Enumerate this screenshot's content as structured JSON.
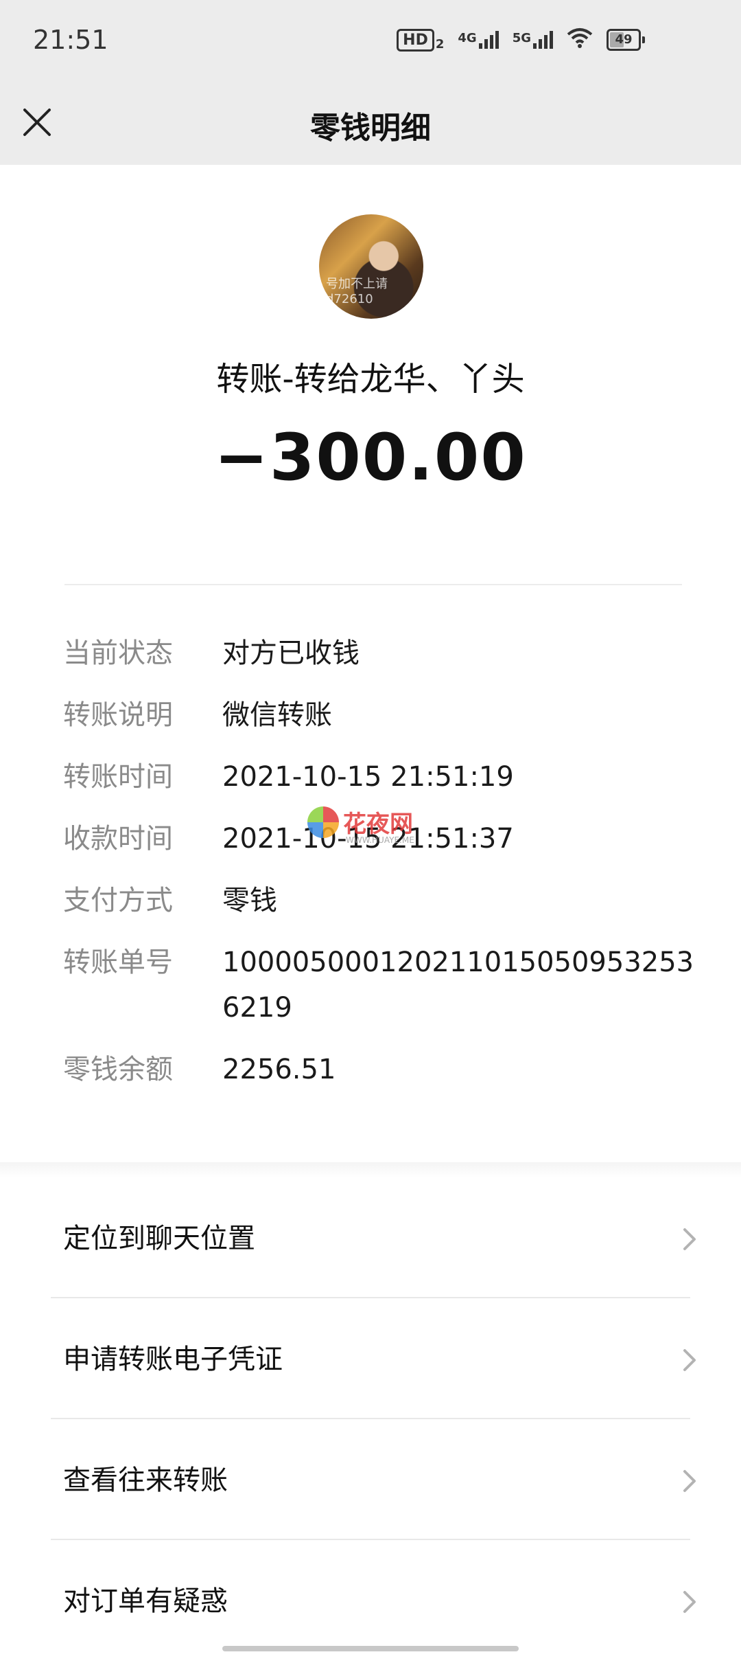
{
  "status_bar": {
    "time": "21:51",
    "hd_label": "HD",
    "hd_sub": "2",
    "net1": "4G",
    "net2": "5G",
    "battery": "49",
    "icons": [
      "hd-icon",
      "signal-4g-icon",
      "signal-5g-icon",
      "wifi-icon",
      "battery-icon"
    ]
  },
  "navbar": {
    "title": "零钱明细",
    "close_icon": "close-icon"
  },
  "transaction": {
    "title": "转账-转给龙华、丫头",
    "amount": "−300.00",
    "avatar_text": "号加不上请\nd72610"
  },
  "details": [
    {
      "label": "当前状态",
      "value": "对方已收钱"
    },
    {
      "label": "转账说明",
      "value": "微信转账"
    },
    {
      "label": "转账时间",
      "value": "2021-10-15 21:51:19"
    },
    {
      "label": "收款时间",
      "value": "2021-10-15 21:51:37"
    },
    {
      "label": "支付方式",
      "value": "零钱"
    },
    {
      "label": "转账单号",
      "value": "1000050001202110150509532536219"
    },
    {
      "label": "零钱余额",
      "value": "2256.51"
    }
  ],
  "watermark": {
    "text": "花夜网",
    "sub": "WWW.HUAYE.ME"
  },
  "menu": [
    {
      "label": "定位到聊天位置"
    },
    {
      "label": "申请转账电子凭证"
    },
    {
      "label": "查看往来转账"
    },
    {
      "label": "对订单有疑惑"
    }
  ]
}
